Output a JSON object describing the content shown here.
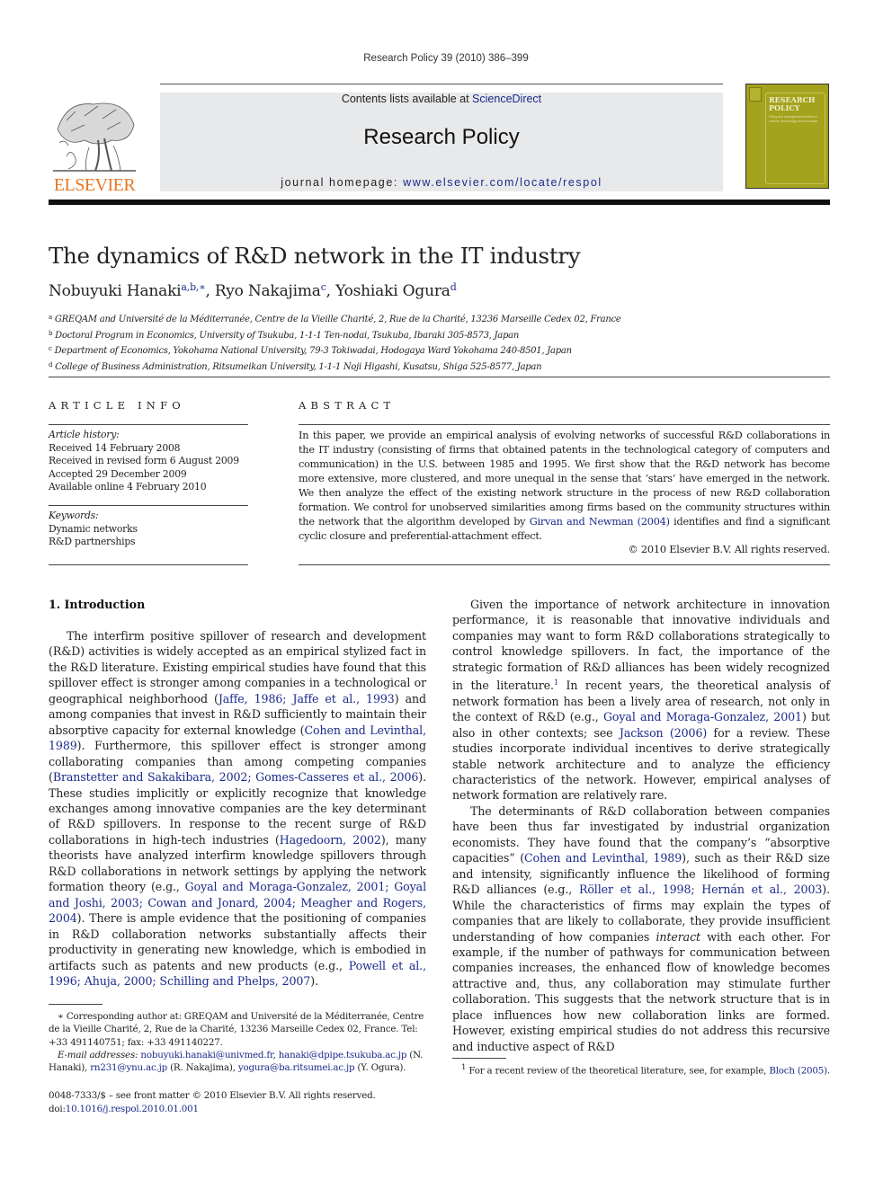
{
  "running_head": "Research Policy 39 (2010) 386–399",
  "header": {
    "contents_prefix": "Contents lists available at ",
    "contents_link": "ScienceDirect",
    "journal_name": "Research Policy",
    "homepage_prefix": "journal homepage: ",
    "homepage_link": "www.elsevier.com/locate/respol",
    "publisher_logo_text": "ELSEVIER",
    "publisher_logo_icon": "tree-icon",
    "cover_title_line1": "RESEARCH",
    "cover_title_line2": "POLICY",
    "cover_subtitle": "Policy and management studies of science, technology and innovation",
    "colors": {
      "logo_orange": "#e87722",
      "cover_olive": "#a5a21e",
      "link_blue": "#1a2a8a",
      "banner_grey": "#e8e9eb"
    }
  },
  "article": {
    "title": "The dynamics of R&D network in the IT industry",
    "authors": [
      {
        "name": "Nobuyuki Hanaki",
        "marks": "a,b,∗",
        "sep": ", "
      },
      {
        "name": "Ryo Nakajima",
        "marks": "c",
        "sep": ", "
      },
      {
        "name": "Yoshiaki Ogura",
        "marks": "d",
        "sep": ""
      }
    ],
    "affiliations": [
      {
        "mark": "a",
        "text": "GREQAM and Université de la Méditerranée, Centre de la Vieille Charité, 2, Rue de la Charité, 13236 Marseille Cedex 02, France"
      },
      {
        "mark": "b",
        "text": "Doctoral Program in Economics, University of Tsukuba, 1-1-1 Ten-nodai, Tsukuba, Ibaraki 305-8573, Japan"
      },
      {
        "mark": "c",
        "text": "Department of Economics, Yokohama National University, 79-3 Tokiwadai, Hodogaya Ward Yokohama 240-8501, Japan"
      },
      {
        "mark": "d",
        "text": "College of Business Administration, Ritsumeikan University, 1-1-1 Noji Higashi, Kusatsu, Shiga 525-8577, Japan"
      }
    ]
  },
  "article_info": {
    "heading": "ARTICLE INFO",
    "history_label": "Article history:",
    "history": [
      "Received 14 February 2008",
      "Received in revised form 6 August 2009",
      "Accepted 29 December 2009",
      "Available online 4 February 2010"
    ],
    "keywords_label": "Keywords:",
    "keywords": [
      "Dynamic networks",
      "R&D partnerships"
    ]
  },
  "abstract": {
    "heading": "ABSTRACT",
    "text_before_link": "In this paper, we provide an empirical analysis of evolving networks of successful R&D collaborations in the IT industry (consisting of firms that obtained patents in the technological category of computers and communication) in the U.S. between 1985 and 1995. We first show that the R&D network has become more extensive, more clustered, and more unequal in the sense that ‘stars’ have emerged in the network. We then analyze the effect of the existing network structure in the process of new R&D collaboration formation. We control for unobserved similarities among firms based on the community structures within the network that the algorithm developed by ",
    "link": "Girvan and Newman (2004)",
    "text_after_link": " identifies and find a significant cyclic closure and preferential-attachment effect.",
    "copyright": "© 2010 Elsevier B.V. All rights reserved."
  },
  "intro": {
    "heading": "1.  Introduction",
    "left_paragraph": [
      {
        "t": "The interfirm positive spillover of research and development (R&D) activities is widely accepted as an empirical stylized fact in the R&D literature. Existing empirical studies have found that this spillover effect is stronger among companies in a technological or geographical neighborhood ("
      },
      {
        "l": "Jaffe, 1986; Jaffe et al., 1993"
      },
      {
        "t": ") and among companies that invest in R&D sufficiently to maintain their absorptive capacity for external knowledge ("
      },
      {
        "l": "Cohen and Levinthal, 1989"
      },
      {
        "t": "). Furthermore, this spillover effect is stronger among collaborating companies than among competing companies ("
      },
      {
        "l": "Branstetter and Sakakibara, 2002; Gomes-Casseres et al., 2006"
      },
      {
        "t": "). These studies implicitly or explicitly recognize that knowledge exchanges among innovative companies are the key determinant of R&D spillovers. In response to the recent surge of R&D collaborations in high-tech industries ("
      },
      {
        "l": "Hagedoorn, 2002"
      },
      {
        "t": "), many theorists have analyzed interfirm knowledge spillovers through R&D collaborations in network settings by applying the network formation theory (e.g., "
      },
      {
        "l": "Goyal and Moraga-Gonzalez, 2001; Goyal and Joshi, 2003; Cowan and Jonard, 2004; Meagher and Rogers, 2004"
      },
      {
        "t": "). There is ample evidence that the positioning of companies in R&D collaboration networks substantially affects their productivity in generating new knowledge, which is embodied in artifacts such as patents and new products (e.g., "
      },
      {
        "l": "Powell et al., 1996; Ahuja, 2000; Schilling and Phelps, 2007"
      },
      {
        "t": ")."
      }
    ],
    "right_paragraph_1": [
      {
        "t": "Given the importance of network architecture in innovation performance, it is reasonable that innovative individuals and companies may want to form R&D collaborations strategically to control knowledge spillovers. In fact, the importance of the strategic formation of R&D alliances has been widely recognized in the literature."
      },
      {
        "s": "1"
      },
      {
        "t": " In recent years, the theoretical analysis of network formation has been a lively area of research, not only in the context of R&D (e.g., "
      },
      {
        "l": "Goyal and Moraga-Gonzalez, 2001"
      },
      {
        "t": ") but also in other contexts; see "
      },
      {
        "l": "Jackson (2006)"
      },
      {
        "t": " for a review. These studies incorporate individual incentives to derive strategically stable network architecture and to analyze the efficiency characteristics of the network. However, empirical analyses of network formation are relatively rare."
      }
    ],
    "right_paragraph_2": [
      {
        "t": "The determinants of R&D collaboration between companies have been thus far investigated by industrial organization economists. They have found that the company’s “absorptive capacities” ("
      },
      {
        "l": "Cohen and Levinthal, 1989"
      },
      {
        "t": "), such as their R&D size and intensity, significantly influence the likelihood of forming R&D alliances (e.g., "
      },
      {
        "l": "Röller et al., 1998; Hernán et al., 2003"
      },
      {
        "t": "). While the characteristics of firms may explain the types of companies that are likely to collaborate, they provide insufficient understanding of how companies "
      },
      {
        "i": "interact"
      },
      {
        "t": " with each other. For example, if the number of pathways for communication between companies increases, the enhanced flow of knowledge becomes attractive and, thus, any collaboration may stimulate further collaboration. This suggests that the network structure that is in place influences how new collaboration links are formed. However, existing empirical studies do not address this recursive and inductive aspect of R&D"
      }
    ]
  },
  "footnotes": {
    "corresponding": "∗  Corresponding author at: GREQAM and Université de la Méditerranée, Centre de la Vieille Charité, 2, Rue de la Charité, 13236 Marseille Cedex 02, France. Tel: +33 491140751; fax: +33 491140227.",
    "email_label": "E-mail addresses:",
    "emails": [
      {
        "t": " "
      },
      {
        "l": "nobuyuki.hanaki@univmed.fr"
      },
      {
        "t": ", "
      },
      {
        "l": "hanaki@dpipe.tsukuba.ac.jp"
      },
      {
        "t": " (N. Hanaki), "
      },
      {
        "l": "rn231@ynu.ac.jp"
      },
      {
        "t": " (R. Nakajima), "
      },
      {
        "l": "yogura@ba.ritsumei.ac.jp"
      },
      {
        "t": " (Y. Ogura)."
      }
    ],
    "fn1_mark": "1",
    "fn1_text": "  For a recent review of the theoretical literature, see, for example, ",
    "fn1_link": "Bloch (2005)",
    "fn1_end": "."
  },
  "front_matter": {
    "issn_line": "0048-7333/$ – see front matter © 2010 Elsevier B.V. All rights reserved.",
    "doi_prefix": "doi:",
    "doi": "10.1016/j.respol.2010.01.001"
  }
}
